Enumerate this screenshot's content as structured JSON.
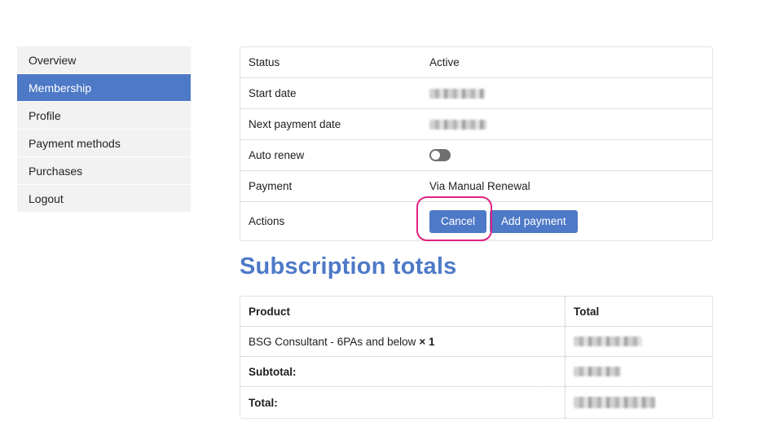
{
  "sidebar": {
    "items": [
      {
        "label": "Overview"
      },
      {
        "label": "Membership"
      },
      {
        "label": "Profile"
      },
      {
        "label": "Payment methods"
      },
      {
        "label": "Purchases"
      },
      {
        "label": "Logout"
      }
    ],
    "active_index": 1
  },
  "subscription": {
    "status_label": "Status",
    "status_value": "Active",
    "start_date_label": "Start date",
    "next_payment_label": "Next payment date",
    "auto_renew_label": "Auto renew",
    "auto_renew_on": false,
    "payment_label": "Payment",
    "payment_value": "Via Manual Renewal",
    "actions_label": "Actions",
    "cancel_label": "Cancel",
    "add_payment_label": "Add payment"
  },
  "totals": {
    "title": "Subscription totals",
    "col_product": "Product",
    "col_total": "Total",
    "item_name": "BSG Consultant - 6PAs and below",
    "item_qty": "× 1",
    "subtotal_label": "Subtotal:",
    "total_label": "Total:"
  },
  "colors": {
    "accent": "#4d79c7",
    "highlight": "#e0217f",
    "toggle_off": "#6f6f6f"
  }
}
